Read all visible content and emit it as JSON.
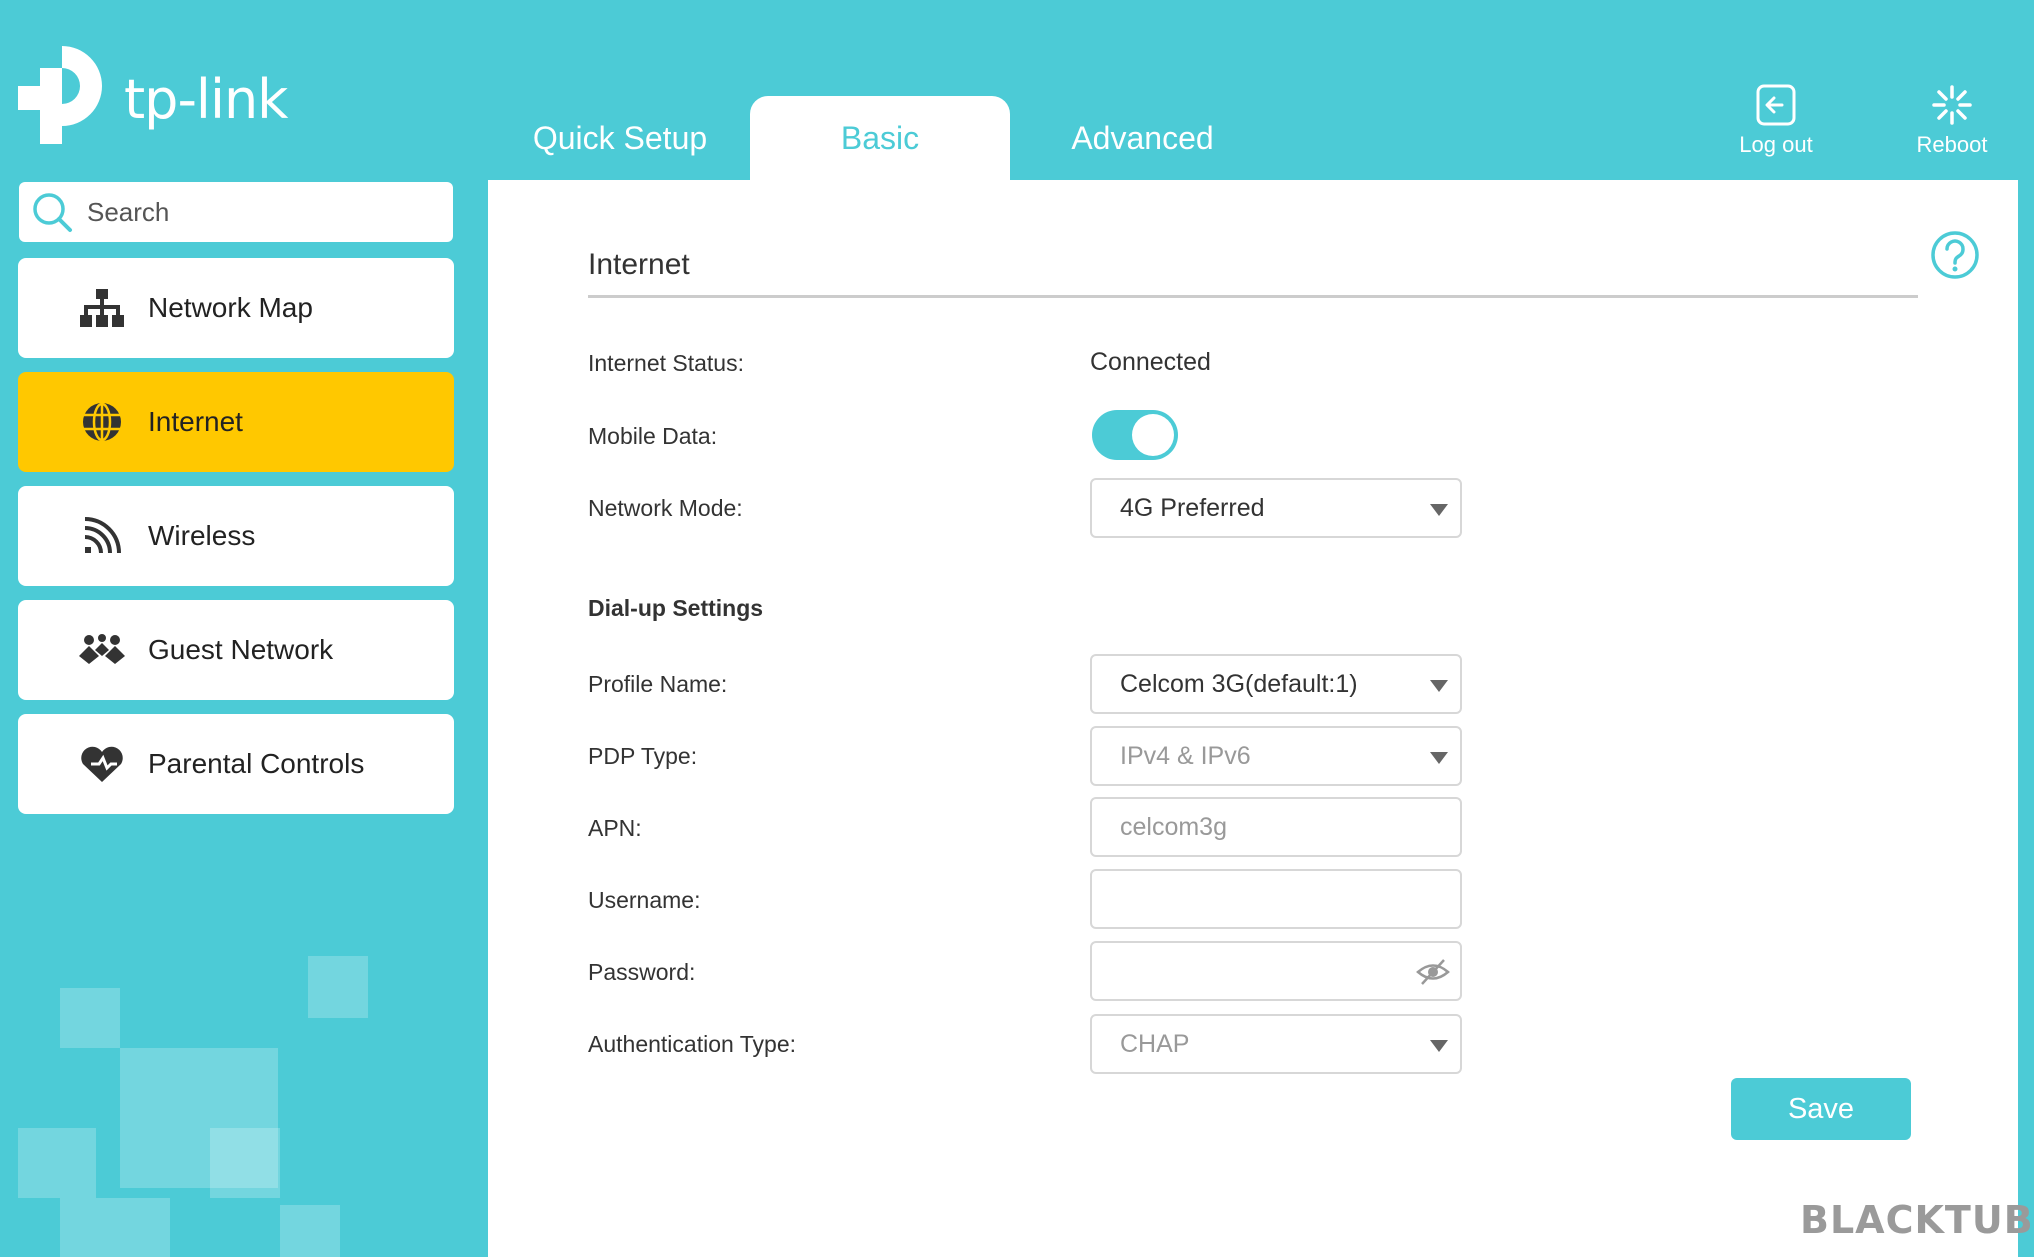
{
  "brand": {
    "logo_text": "tp-link",
    "accent": "#4ccbd6",
    "highlight": "#ffc800"
  },
  "tabs": [
    {
      "label": "Quick Setup",
      "active": false
    },
    {
      "label": "Basic",
      "active": true
    },
    {
      "label": "Advanced",
      "active": false
    }
  ],
  "top_actions": {
    "logout_label": "Log out",
    "reboot_label": "Reboot"
  },
  "search": {
    "placeholder": "Search"
  },
  "sidebar": {
    "items": [
      {
        "label": "Network Map",
        "icon": "network-map-icon",
        "active": false
      },
      {
        "label": "Internet",
        "icon": "globe-icon",
        "active": true
      },
      {
        "label": "Wireless",
        "icon": "wireless-icon",
        "active": false
      },
      {
        "label": "Guest Network",
        "icon": "guest-icon",
        "active": false
      },
      {
        "label": "Parental Controls",
        "icon": "heart-icon",
        "active": false
      }
    ]
  },
  "main": {
    "section_title": "Internet",
    "internet_status": {
      "label": "Internet Status:",
      "value": "Connected"
    },
    "mobile_data": {
      "label": "Mobile Data:",
      "enabled": true
    },
    "network_mode": {
      "label": "Network Mode:",
      "value": "4G Preferred"
    },
    "dialup_heading": "Dial-up Settings",
    "profile_name": {
      "label": "Profile Name:",
      "value": "Celcom 3G(default:1)"
    },
    "pdp_type": {
      "label": "PDP Type:",
      "value": "IPv4 & IPv6"
    },
    "apn": {
      "label": "APN:",
      "value": "celcom3g"
    },
    "username": {
      "label": "Username:",
      "value": ""
    },
    "password": {
      "label": "Password:",
      "value": ""
    },
    "auth_type": {
      "label": "Authentication Type:",
      "value": "CHAP"
    },
    "save_label": "Save"
  },
  "watermark": "BLACKTUBI"
}
